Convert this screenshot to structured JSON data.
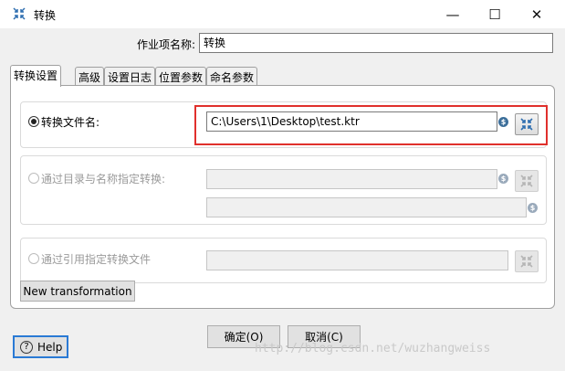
{
  "window": {
    "title": "转换",
    "controls": {
      "minimize": "—",
      "maximize": "☐",
      "close": "✕"
    }
  },
  "job_entry": {
    "name_label": "作业项名称:",
    "name_value": "转换"
  },
  "tabs": [
    {
      "label": "转换设置",
      "active": true
    },
    {
      "label": "高级",
      "active": false
    },
    {
      "label": "设置日志",
      "active": false
    },
    {
      "label": "位置参数",
      "active": false
    },
    {
      "label": "命名参数",
      "active": false
    }
  ],
  "options": {
    "by_filename": {
      "label": "转换文件名:",
      "selected": true,
      "value": "C:\\Users\\1\\Desktop\\test.ktr"
    },
    "by_directory": {
      "label": "通过目录与名称指定转换:",
      "selected": false,
      "dir_value": "",
      "name_value": ""
    },
    "by_reference": {
      "label": "通过引用指定转换文件",
      "selected": false,
      "value": ""
    }
  },
  "buttons": {
    "new_transformation": "New transformation",
    "ok": "确定(O)",
    "cancel": "取消(C)",
    "help": "Help"
  },
  "watermark": "http://blog.csdn.net/wuzhangweiss",
  "colors": {
    "highlight_border": "#e0302c",
    "help_border": "#2a7ad5",
    "variable_icon": "#3d6f9a"
  }
}
